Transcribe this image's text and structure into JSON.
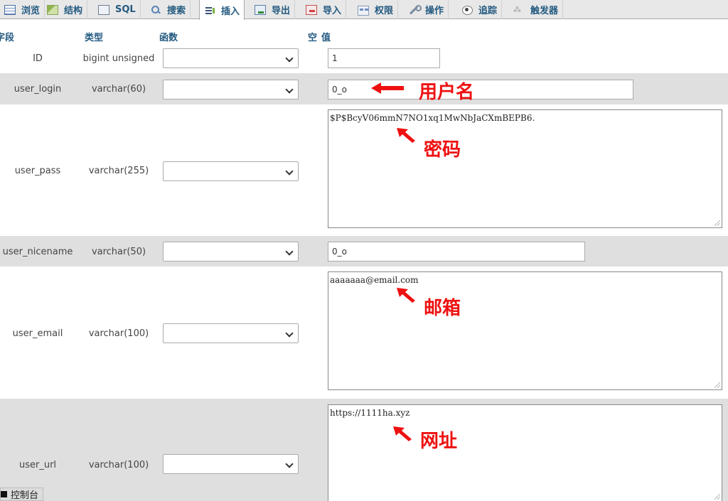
{
  "tabs": [
    {
      "id": "browse",
      "label": "浏览",
      "icon": "table-browse-icon"
    },
    {
      "id": "structure",
      "label": "结构",
      "icon": "structure-icon"
    },
    {
      "id": "sql",
      "label": "SQL",
      "icon": "sql-document-icon"
    },
    {
      "id": "search",
      "label": "搜索",
      "icon": "magnifier-search-icon"
    },
    {
      "id": "insert",
      "label": "插入",
      "icon": "insert-rows-icon"
    },
    {
      "id": "export",
      "label": "导出",
      "icon": "export-icon"
    },
    {
      "id": "import",
      "label": "导入",
      "icon": "import-icon"
    },
    {
      "id": "privileges",
      "label": "权限",
      "icon": "privileges-icon"
    },
    {
      "id": "operations",
      "label": "操作",
      "icon": "wrench-icon"
    },
    {
      "id": "tracking",
      "label": "追踪",
      "icon": "eye-tracking-icon"
    },
    {
      "id": "triggers",
      "label": "触发器",
      "icon": "triggers-icon"
    }
  ],
  "active_tab": "insert",
  "headers": {
    "field": "字段",
    "type": "类型",
    "function": "函数",
    "null": "空",
    "value": "值"
  },
  "rows": [
    {
      "field": "ID",
      "type": "bigint unsigned",
      "value": "1"
    },
    {
      "field": "user_login",
      "type": "varchar(60)",
      "value": "0_o"
    },
    {
      "field": "user_pass",
      "type": "varchar(255)",
      "value": "$P$BcyV06mmN7NO1xq1MwNbJaCXmBEPB6."
    },
    {
      "field": "user_nicename",
      "type": "varchar(50)",
      "value": "0_o"
    },
    {
      "field": "user_email",
      "type": "varchar(100)",
      "value": "aaaaaaa@email.com"
    },
    {
      "field": "user_url",
      "type": "varchar(100)",
      "value": "https://1111ha.xyz"
    }
  ],
  "annotations": {
    "username": "用户名",
    "password": "密码",
    "email": "邮箱",
    "url": "网址"
  },
  "console": {
    "label": "控制台"
  },
  "colors": {
    "annotation": "#ee1111",
    "link": "#235a81",
    "row_alt": "#dfdfdf",
    "tabbar": "#e8e8e8"
  }
}
